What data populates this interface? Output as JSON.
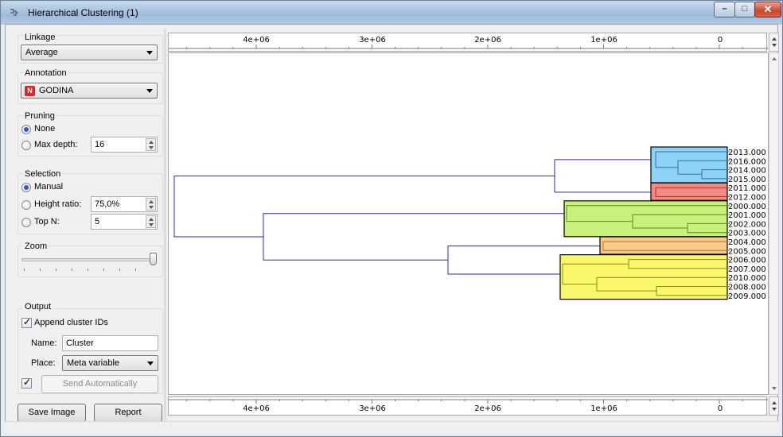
{
  "window": {
    "title": "Hierarchical Clustering (1)",
    "icon": "dendrogram-icon",
    "controls": {
      "minimize": "–",
      "maximize": "□",
      "close": "✕"
    }
  },
  "linkage": {
    "label": "Linkage",
    "selected": "Average"
  },
  "annotation": {
    "label": "Annotation",
    "selected": "GODINA",
    "badge": "N"
  },
  "pruning": {
    "label": "Pruning",
    "none_label": "None",
    "max_depth_label": "Max depth:",
    "max_depth_value": "16",
    "selected": "None"
  },
  "selection": {
    "label": "Selection",
    "manual_label": "Manual",
    "height_ratio_label": "Height ratio:",
    "height_ratio_value": "75,0%",
    "top_n_label": "Top N:",
    "top_n_value": "5",
    "selected": "Manual"
  },
  "zoom": {
    "label": "Zoom",
    "level": 1.0
  },
  "output": {
    "label": "Output",
    "append_label": "Append cluster IDs",
    "append_checked": true,
    "name_label": "Name:",
    "name_value": "Cluster",
    "place_label": "Place:",
    "place_value": "Meta variable",
    "auto_send_checked": true,
    "send_label": "Send Automatically"
  },
  "footer": {
    "save_image": "Save Image",
    "report": "Report"
  },
  "axis": {
    "ticks": [
      "4e+06",
      "3e+06",
      "2e+06",
      "1e+06",
      "0"
    ]
  },
  "colors": {
    "line": "#2a2aa8",
    "cluster_blue": "#8dd3f5",
    "cluster_red": "#f28a82",
    "cluster_green": "#c8f07a",
    "cluster_orange": "#f7c98a",
    "cluster_yellow": "#f8f86a"
  },
  "dendrogram": {
    "leaves": [
      "2013.000",
      "2016.000",
      "2014.000",
      "2015.000",
      "2011.000",
      "2012.000",
      "2000.000",
      "2001.000",
      "2002.000",
      "2003.000",
      "2004.000",
      "2005.000",
      "2006.000",
      "2007.000",
      "2010.000",
      "2008.000",
      "2009.000"
    ]
  }
}
